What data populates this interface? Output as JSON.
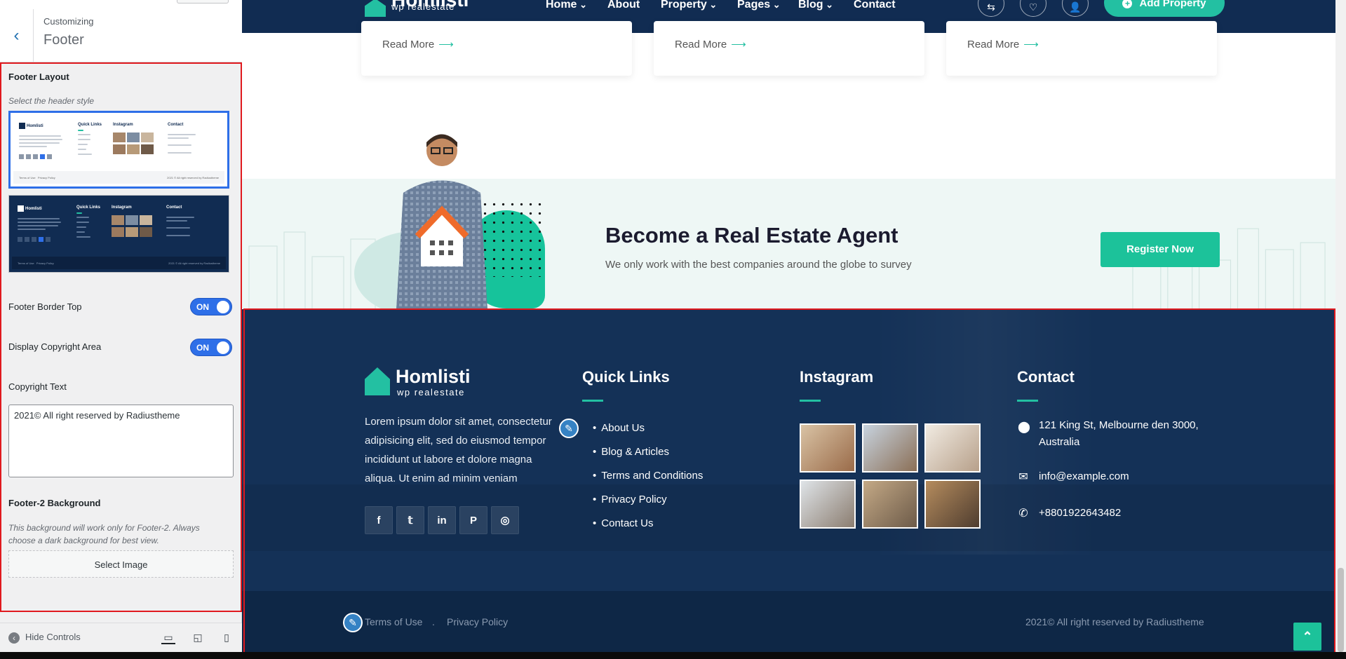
{
  "customizer": {
    "breadcrumb": "Customizing",
    "title": "Footer",
    "footer_layout": {
      "heading": "Footer Layout",
      "description": "Select the header style",
      "thumb_logo": "Homlisti",
      "thumb_cols": [
        "Quick Links",
        "Instagram",
        "Contact"
      ],
      "thumb_links": [
        "About Us",
        "Services",
        "FAQ",
        "Blog",
        "Contact Us"
      ],
      "thumb_contact": [
        "121 King St, Melbourne den 3000, Australia",
        "info@example.com",
        "+1 234 5678 900"
      ],
      "thumb_bottom_left": [
        "Terms of Use",
        "Privacy Policy"
      ],
      "thumb_bottom_right": "2021 © All right reserved by Radiustheme"
    },
    "footer_border_top": {
      "label": "Footer Border Top",
      "state": "ON"
    },
    "display_copyright": {
      "label": "Display Copyright Area",
      "state": "ON"
    },
    "copyright_text": {
      "label": "Copyright Text",
      "value": "2021© All right reserved by Radiustheme"
    },
    "footer2_bg": {
      "label": "Footer-2 Background",
      "description": "This background will work only for Footer-2. Always choose a dark background for best view.",
      "button": "Select Image"
    },
    "hide_controls": "Hide Controls",
    "devices": [
      "desktop-icon",
      "tablet-icon",
      "mobile-icon"
    ]
  },
  "site": {
    "logo": {
      "name": "Homlisti",
      "tagline": "wp realestate"
    },
    "nav": [
      {
        "label": "Home",
        "dropdown": true
      },
      {
        "label": "About",
        "dropdown": false
      },
      {
        "label": "Property",
        "dropdown": true
      },
      {
        "label": "Pages",
        "dropdown": true
      },
      {
        "label": "Blog",
        "dropdown": true
      },
      {
        "label": "Contact",
        "dropdown": false
      }
    ],
    "add_property": "Add Property",
    "read_more": "Read More",
    "agent": {
      "title": "Become a Real Estate Agent",
      "subtitle": "We only work with the best companies around the globe to survey",
      "button": "Register Now"
    },
    "footer": {
      "about": "Lorem ipsum dolor sit amet, consectetur adipisicing elit, sed do eiusmod tempor incididunt ut labore et dolore magna aliqua. Ut enim ad minim veniam",
      "social": [
        "f",
        "twitter",
        "in",
        "p",
        "instagram"
      ],
      "quick_links_title": "Quick Links",
      "quick_links": [
        "About Us",
        "Blog & Articles",
        "Terms and Conditions",
        "Privacy Policy",
        "Contact Us"
      ],
      "instagram_title": "Instagram",
      "contact_title": "Contact",
      "address": "121 King St, Melbourne den 3000, Australia",
      "email": "info@example.com",
      "phone": "+8801922643482",
      "bottom_links": [
        "Terms of Use",
        "Privacy Policy"
      ],
      "copyright": "2021© All right reserved by Radiustheme"
    }
  },
  "colors": {
    "accent": "#23c0a2",
    "navy": "#112c52",
    "toggle": "#2e6fe8",
    "highlight": "#e0191e"
  }
}
